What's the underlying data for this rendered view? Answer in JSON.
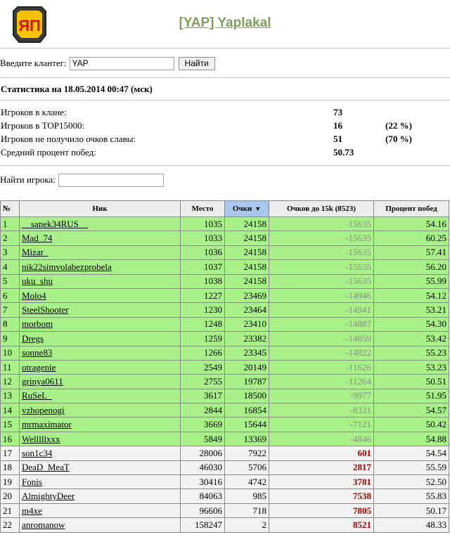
{
  "header": {
    "title": "[YAP] Yaplakal",
    "logo_text": "ЯП"
  },
  "search": {
    "label": "Введите клантег:",
    "value": "YAP",
    "button": "Найти"
  },
  "stats": {
    "title": "Статистика на 18.05.2014 00:47 (мск)",
    "rows": [
      {
        "label": "Игроков в клане:",
        "value": "73",
        "pct": ""
      },
      {
        "label": "Игроков в TOP15000:",
        "value": "16",
        "pct": "(22 %)"
      },
      {
        "label": "Игроков не получило очков славы:",
        "value": "51",
        "pct": "(70 %)"
      },
      {
        "label": "Средний процент побед:",
        "value": "50.73",
        "pct": ""
      }
    ]
  },
  "find_player": {
    "label": "Найти игрока:",
    "value": ""
  },
  "table": {
    "columns": [
      "№",
      "Ник",
      "Место",
      "Очки",
      "Очков до 15k (8523)",
      "Процент побед"
    ],
    "sorted_column": 3,
    "rows": [
      {
        "n": "1",
        "nick": "__sanek34RUS__",
        "place": "1035",
        "points": "24158",
        "gap": "-15635",
        "win": "54.16",
        "top": true
      },
      {
        "n": "2",
        "nick": "Mad_74",
        "place": "1033",
        "points": "24158",
        "gap": "-15635",
        "win": "60.25",
        "top": true
      },
      {
        "n": "3",
        "nick": "Mizar_",
        "place": "1036",
        "points": "24158",
        "gap": "-15635",
        "win": "57.41",
        "top": true
      },
      {
        "n": "4",
        "nick": "nik22simvolabezprobela",
        "place": "1037",
        "points": "24158",
        "gap": "-15635",
        "win": "56.20",
        "top": true
      },
      {
        "n": "5",
        "nick": "uku_shu",
        "place": "1038",
        "points": "24158",
        "gap": "-15635",
        "win": "55.99",
        "top": true
      },
      {
        "n": "6",
        "nick": "Molo4",
        "place": "1227",
        "points": "23469",
        "gap": "-14946",
        "win": "54.12",
        "top": true
      },
      {
        "n": "7",
        "nick": "SteelShooter",
        "place": "1230",
        "points": "23464",
        "gap": "-14941",
        "win": "53.21",
        "top": true
      },
      {
        "n": "8",
        "nick": "morbom",
        "place": "1248",
        "points": "23410",
        "gap": "-14887",
        "win": "54.30",
        "top": true
      },
      {
        "n": "9",
        "nick": "Dregs",
        "place": "1259",
        "points": "23382",
        "gap": "-14859",
        "win": "53.42",
        "top": true
      },
      {
        "n": "10",
        "nick": "sonne83",
        "place": "1266",
        "points": "23345",
        "gap": "-14822",
        "win": "55.23",
        "top": true
      },
      {
        "n": "11",
        "nick": "otragenie",
        "place": "2549",
        "points": "20149",
        "gap": "-11626",
        "win": "53.23",
        "top": true
      },
      {
        "n": "12",
        "nick": "grinya0611",
        "place": "2755",
        "points": "19787",
        "gap": "-11264",
        "win": "50.51",
        "top": true
      },
      {
        "n": "13",
        "nick": "RuSeL_",
        "place": "3617",
        "points": "18500",
        "gap": "-9977",
        "win": "51.95",
        "top": true
      },
      {
        "n": "14",
        "nick": "vzhopenogi",
        "place": "2844",
        "points": "16854",
        "gap": "-8331",
        "win": "54.57",
        "top": true
      },
      {
        "n": "15",
        "nick": "mrmaximator",
        "place": "3669",
        "points": "15644",
        "gap": "-7121",
        "win": "50.42",
        "top": true
      },
      {
        "n": "16",
        "nick": "Welllllxxx",
        "place": "5849",
        "points": "13369",
        "gap": "-4846",
        "win": "54.88",
        "top": true
      },
      {
        "n": "17",
        "nick": "son1c34",
        "place": "28006",
        "points": "7922",
        "gap": "601",
        "win": "54.54",
        "top": false
      },
      {
        "n": "18",
        "nick": "DeaD_MeaT",
        "place": "46030",
        "points": "5706",
        "gap": "2817",
        "win": "55.59",
        "top": false
      },
      {
        "n": "19",
        "nick": "Fonis",
        "place": "30416",
        "points": "4742",
        "gap": "3781",
        "win": "52.50",
        "top": false
      },
      {
        "n": "20",
        "nick": "AlmightyDeer",
        "place": "84063",
        "points": "985",
        "gap": "7538",
        "win": "55.83",
        "top": false
      },
      {
        "n": "21",
        "nick": "m4xe",
        "place": "96606",
        "points": "718",
        "gap": "7805",
        "win": "50.17",
        "top": false
      },
      {
        "n": "22",
        "nick": "anromanow",
        "place": "158247",
        "points": "2",
        "gap": "8521",
        "win": "48.33",
        "top": false
      }
    ]
  },
  "colors": {
    "top_row": "#a8f088",
    "other_row": "#f2f2f2",
    "title_link": "#7ba05b",
    "gap_positive": "#a00000",
    "sorted_header": "#a8c8f0"
  }
}
